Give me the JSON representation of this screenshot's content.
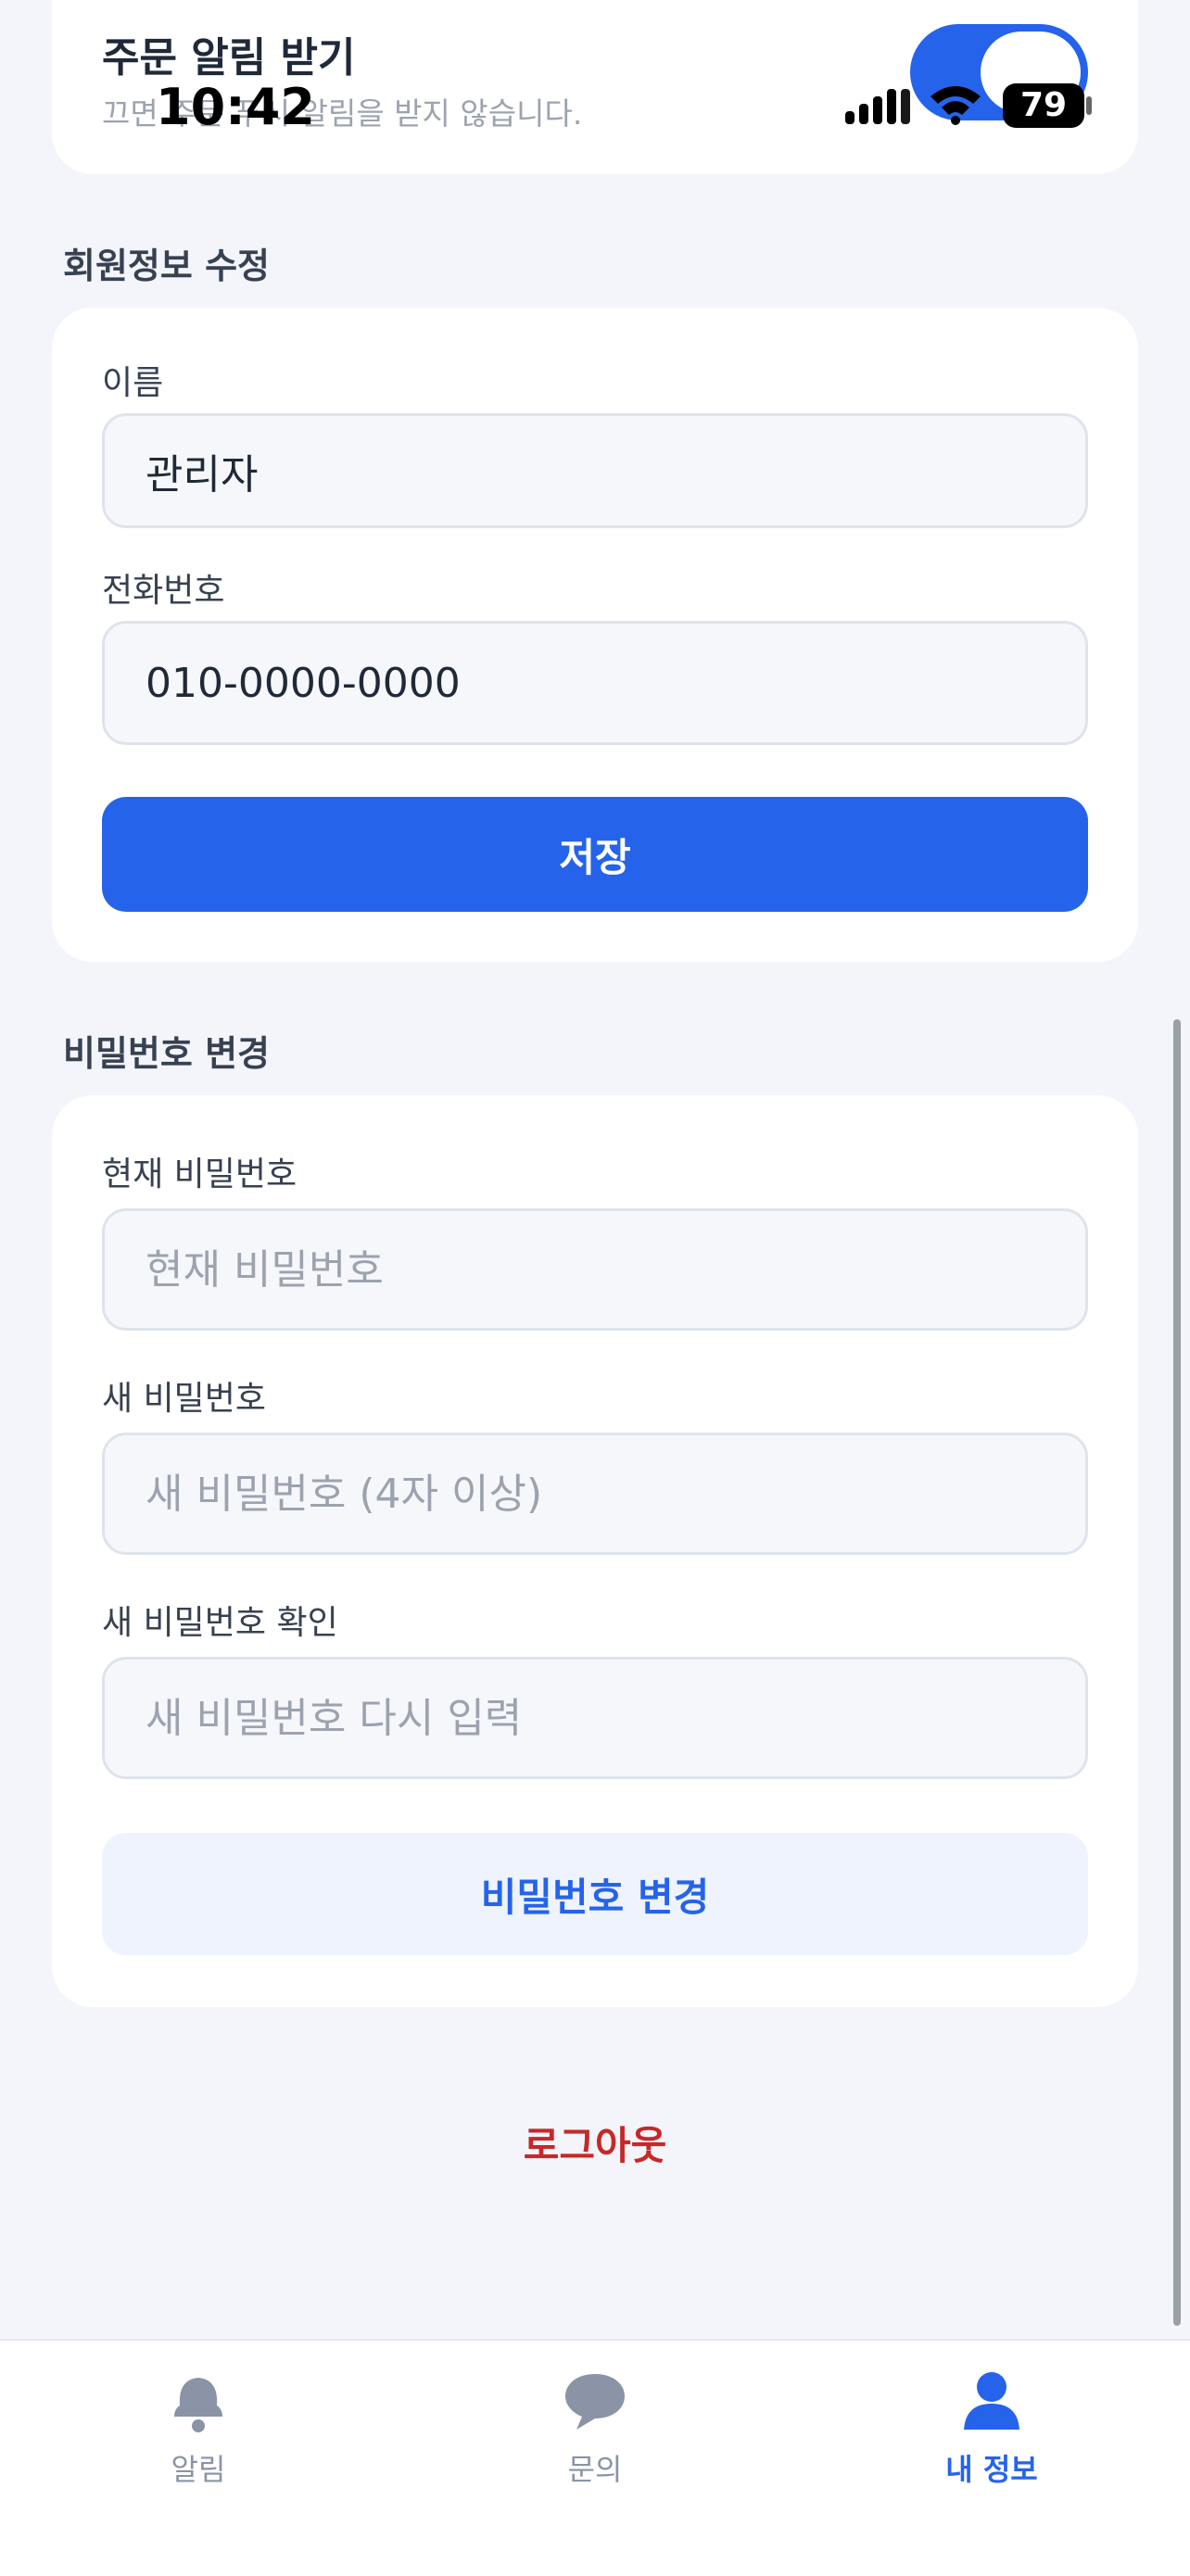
{
  "status_bar": {
    "time": "10:42",
    "battery": "79"
  },
  "notification": {
    "title": "주문 알림 받기",
    "description": "끄면 주문 푸시 알림을 받지 않습니다.",
    "enabled": true
  },
  "profile_section": {
    "title": "회원정보 수정",
    "name_label": "이름",
    "name_value": "관리자",
    "phone_label": "전화번호",
    "phone_value": "010-0000-0000",
    "save_label": "저장"
  },
  "password_section": {
    "title": "비밀번호 변경",
    "current_label": "현재 비밀번호",
    "current_placeholder": "현재 비밀번호",
    "new_label": "새 비밀번호",
    "new_placeholder": "새 비밀번호 (4자 이상)",
    "confirm_label": "새 비밀번호 확인",
    "confirm_placeholder": "새 비밀번호 다시 입력",
    "change_label": "비밀번호 변경"
  },
  "logout_label": "로그아웃",
  "tabs": [
    {
      "label": "알림",
      "icon": "bell-icon",
      "active": false
    },
    {
      "label": "문의",
      "icon": "chat-bubble-icon",
      "active": false
    },
    {
      "label": "내 정보",
      "icon": "person-icon",
      "active": true
    }
  ],
  "colors": {
    "accent": "#2563eb",
    "danger": "#c62828",
    "background": "#f3f5fb"
  }
}
